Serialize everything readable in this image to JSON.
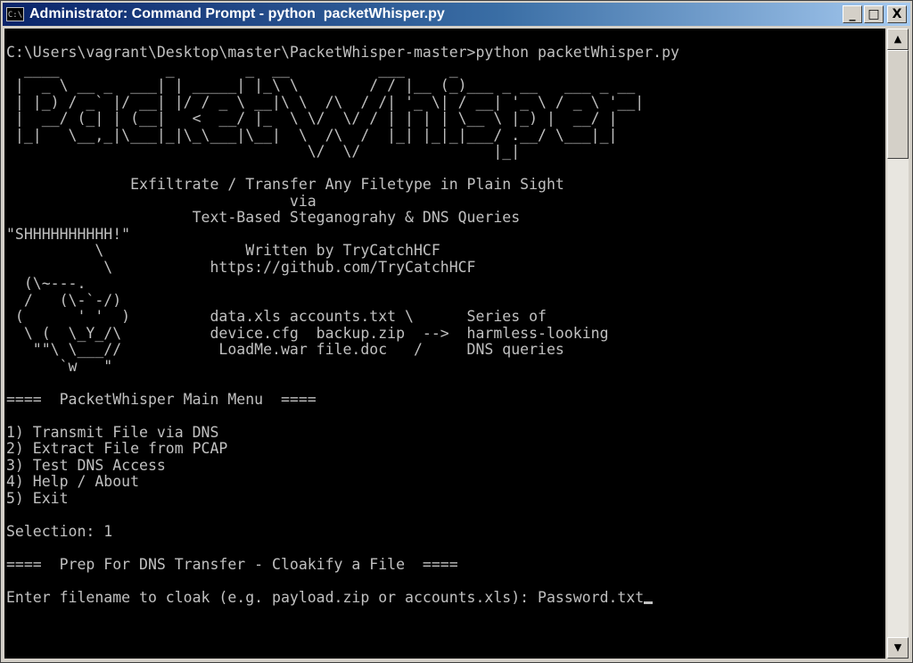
{
  "window": {
    "title": "Administrator: Command Prompt - python  packetWhisper.py",
    "icon_label": "C:\\",
    "minimize_glyph": "_",
    "maximize_glyph": "□",
    "close_glyph": "X"
  },
  "console": {
    "lines": [
      "C:\\Users\\vagrant\\Desktop\\master\\PacketWhisper-master>python packetWhisper.py",
      "  ____            _        _  __          ___     _",
      " |  _ \\ __ _  ___| | _____| |_\\ \\        / / |__ (_)___ _ __   ___ _ __",
      " | |_) / _` |/ __| |/ / _ \\ __|\\ \\  /\\  / /| '_ \\| / __| '_ \\ / _ \\ '__|",
      " |  __/ (_| | (__|   <  __/ |_  \\ \\/  \\/ / | | | | \\__ \\ |_) |  __/ |",
      " |_|   \\__,_|\\___|_|\\_\\___|\\__|  \\  /\\  /  |_| |_|_|___/ .__/ \\___|_|",
      "                                  \\/  \\/               |_|",
      "",
      "              Exfiltrate / Transfer Any Filetype in Plain Sight",
      "                                via",
      "                     Text-Based Steganograhy & DNS Queries",
      "\"SHHHHHHHHHH!\"",
      "          \\                Written by TryCatchHCF",
      "           \\           https://github.com/TryCatchHCF",
      "  (\\~---.",
      "  /   (\\-`-/)",
      " (      ' '  )         data.xls accounts.txt \\      Series of",
      "  \\ (  \\_Y_/\\          device.cfg  backup.zip  -->  harmless-looking",
      "   \"\"\\ \\___//           LoadMe.war file.doc   /     DNS queries",
      "      `w   \"",
      "",
      "====  PacketWhisper Main Menu  ====",
      "",
      "1) Transmit File via DNS",
      "2) Extract File from PCAP",
      "3) Test DNS Access",
      "4) Help / About",
      "5) Exit",
      "",
      "Selection: 1",
      "",
      "====  Prep For DNS Transfer - Cloakify a File  ====",
      ""
    ],
    "prompt": "Enter filename to cloak (e.g. payload.zip or accounts.xls): ",
    "input_value": "Password.txt"
  },
  "scrollbar": {
    "up_glyph": "▲",
    "down_glyph": "▼"
  }
}
